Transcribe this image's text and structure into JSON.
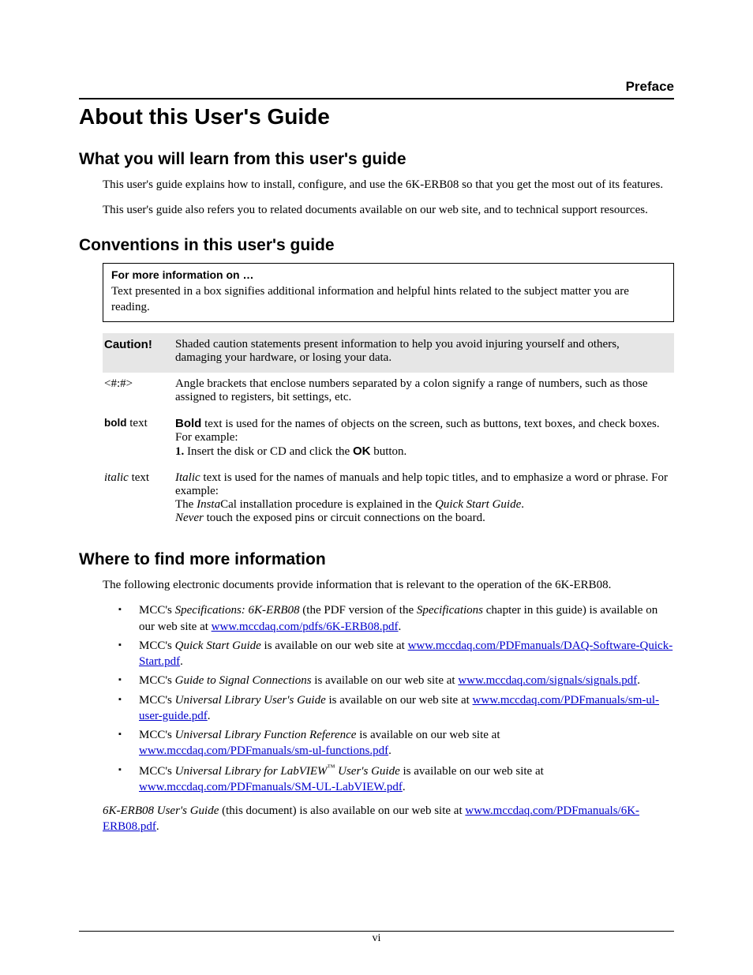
{
  "header": {
    "preface": "Preface"
  },
  "title": "About this User's Guide",
  "section1": {
    "heading": "What you will learn from this user's guide",
    "p1": "This user's guide explains how to install, configure, and use the 6K-ERB08 so that you get the most out of its features.",
    "p2": "This user's guide also refers you to related documents available on our web site, and to technical support resources."
  },
  "section2": {
    "heading": "Conventions in this user's guide",
    "infobox": {
      "title": "For more information on …",
      "text": "Text presented in a box signifies additional information and helpful hints related to the subject matter you are reading."
    },
    "caution": {
      "label": "Caution!",
      "text": "Shaded caution statements present information to help you avoid injuring yourself and others, damaging your hardware, or losing your data."
    },
    "angle": {
      "label": "<#:#>",
      "text": "Angle brackets that enclose numbers separated by a colon signify a range of numbers, such as those assigned to registers, bit settings, etc."
    },
    "bold": {
      "label_bold": "bold",
      "label_tail": " text",
      "t1a": "Bold",
      "t1b": " text is used for the names of objects on the screen, such as buttons, text boxes, and check boxes. For example:",
      "li_num": "1.",
      "li_a": "   Insert the disk or CD and click the ",
      "li_ok": "OK",
      "li_b": " button."
    },
    "italic": {
      "label_italic": "italic",
      "label_tail": " text",
      "t1a": "Italic",
      "t1b": " text is used for the names of manuals and help topic titles, and to emphasize a word or phrase. For example:",
      "t2a": "The ",
      "t2_insta": "Insta",
      "t2b": "Cal installation procedure is explained in the ",
      "t2_qsg": "Quick Start Guide",
      "t2c": ".",
      "t3a": "Never",
      "t3b": " touch the exposed pins or circuit connections on the board."
    }
  },
  "section3": {
    "heading": "Where to find more information",
    "intro": "The following electronic documents provide information that is relevant to the operation of the 6K-ERB08.",
    "items": [
      {
        "pre": "MCC's ",
        "em": "Specifications: 6K-ERB08",
        "mid": " (the PDF version of the ",
        "em2": "Specifications",
        "post": " chapter in this guide) is available on our web site at ",
        "link": "www.mccdaq.com/pdfs/6K-ERB08.pdf",
        "tail": "."
      },
      {
        "pre": "MCC's ",
        "em": "Quick Start Guide",
        "post": " is available on our web site at ",
        "link": "www.mccdaq.com/PDFmanuals/DAQ-Software-Quick-Start.pdf",
        "tail": "."
      },
      {
        "pre": "MCC's ",
        "em": "Guide to Signal Connections",
        "post": " is available on our web site at ",
        "link": "www.mccdaq.com/signals/signals.pdf",
        "tail": "."
      },
      {
        "pre": "MCC's ",
        "em": "Universal Library User's Guide",
        "post": " is available on our web site at ",
        "link": "www.mccdaq.com/PDFmanuals/sm-ul-user-guide.pdf",
        "tail": "."
      },
      {
        "pre": "MCC's ",
        "em": "Universal Library Function Reference",
        "post": " is available on our web site at ",
        "link": "www.mccdaq.com/PDFmanuals/sm-ul-functions.pdf",
        "tail": "."
      },
      {
        "pre": "MCC's ",
        "em": "Universal Library for LabVIEW",
        "tm": "™",
        "em_tail": " User's Guide",
        "post": " is available on our web site at ",
        "link": "www.mccdaq.com/PDFmanuals/SM-UL-LabVIEW.pdf",
        "tail": "."
      }
    ],
    "closing": {
      "em": "6K-ERB08 User's Guide",
      "mid": " (this document) is also available on our web site at ",
      "link": "www.mccdaq.com/PDFmanuals/6K-ERB08.pdf",
      "tail": "."
    }
  },
  "footer": {
    "page": "vi"
  }
}
